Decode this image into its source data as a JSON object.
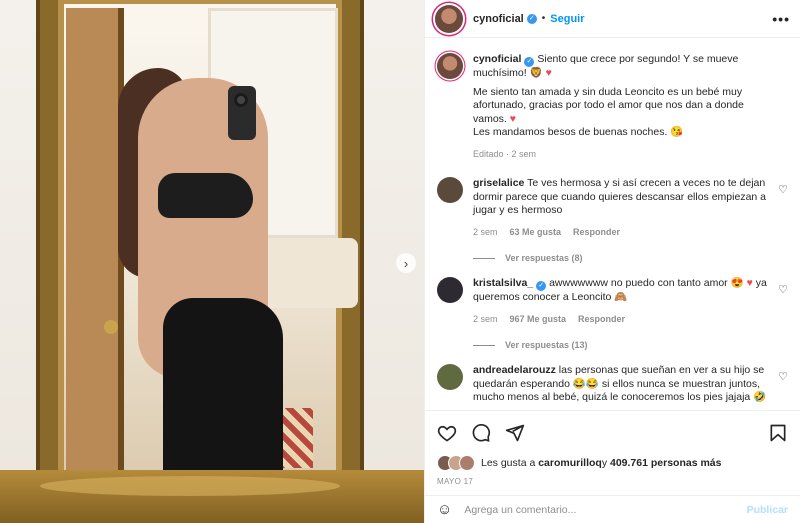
{
  "post": {
    "username": "cynoficial",
    "dot": "•",
    "follow_label": "Seguir",
    "more_label": "•••"
  },
  "caption": {
    "username": "cynoficial",
    "line1": "Siento que crece por segundo! Y se mueve muchísimo! 🦁 ",
    "heart1": "♥",
    "line2": "Me siento tan amada y sin duda Leoncito es un bebé muy afortunado, gracias por todo el amor que nos dan a donde vamos. ",
    "heart2": "♥",
    "line3": "Les mandamos besos de buenas noches. 😘",
    "meta": "Editado · 2 sem"
  },
  "comments": [
    {
      "username": "griselalice",
      "text": "Te ves hermosa y si así crecen a veces no te dejan dormir parece que cuando quieres descansar ellos empiezan a jugar y es hermoso",
      "time": "2 sem",
      "likes": "63 Me gusta",
      "reply": "Responder",
      "replies": "Ver respuestas (8)",
      "avatar_color": "#5a4a3c"
    },
    {
      "username": "kristalsilva_",
      "text": "awwwwwww no puedo con tanto amor 😍 ",
      "heart": "♥",
      "text2": " ya queremos conocer a Leoncito 🙈",
      "time": "2 sem",
      "likes": "967 Me gusta",
      "reply": "Responder",
      "replies": "Ver respuestas (13)",
      "avatar_color": "#2d2a34"
    },
    {
      "username": "andreadelarouzz",
      "text": "las personas que sueñan en ver a su hijo se quedarán esperando 😂😂 si ellos nunca se muestran juntos, mucho menos al bebé, quizá le conoceremos los pies jajaja 🤣",
      "avatar_color": "#5f6b3f"
    }
  ],
  "likes_line": {
    "prefix": "Les gusta a ",
    "user": "caromurilloq",
    "middle": " y ",
    "count": "409.761 personas más"
  },
  "date": "MAYO 17",
  "add_comment": {
    "emoji": "☺",
    "placeholder": "Agrega un comentario...",
    "publish": "Publicar"
  },
  "carousel_next": "›",
  "colors": {
    "accent": "#0095f6",
    "verified": "#3897f0",
    "heart": "#ed4956"
  }
}
